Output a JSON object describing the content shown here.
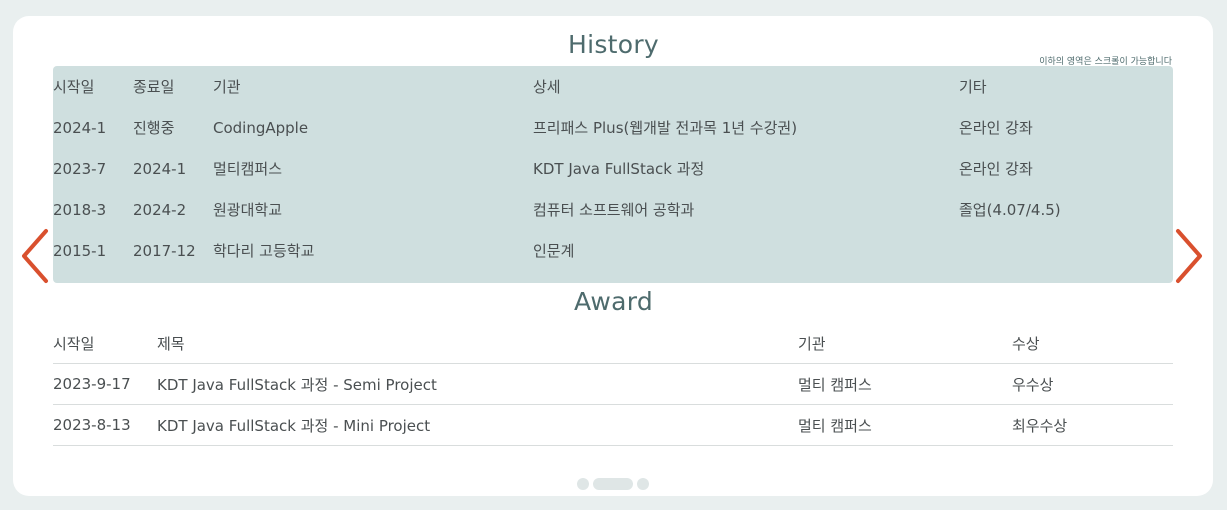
{
  "history": {
    "title": "History",
    "scroll_note": "이하의 영역은 스크롤이 가능합니다",
    "headers": [
      "시작일",
      "종료일",
      "기관",
      "상세",
      "기타"
    ],
    "rows": [
      [
        "2024-1",
        "진행중",
        "CodingApple",
        "프리패스 Plus(웹개발 전과목 1년 수강권)",
        "온라인 강좌"
      ],
      [
        "2023-7",
        "2024-1",
        "멀티캠퍼스",
        "KDT Java FullStack 과정",
        "온라인 강좌"
      ],
      [
        "2018-3",
        "2024-2",
        "원광대학교",
        "컴퓨터 소프트웨어 공학과",
        "졸업(4.07/4.5)"
      ],
      [
        "2015-1",
        "2017-12",
        "학다리 고등학교",
        "인문계",
        ""
      ]
    ]
  },
  "award": {
    "title": "Award",
    "headers": [
      "시작일",
      "제목",
      "기관",
      "수상"
    ],
    "rows": [
      [
        "2023-9-17",
        "KDT Java FullStack 과정 - Semi Project",
        "멀티 캠퍼스",
        "우수상"
      ],
      [
        "2023-8-13",
        "KDT Java FullStack 과정 - Mini Project",
        "멀티 캠퍼스",
        "최우수상"
      ]
    ]
  },
  "nav": {
    "prev_icon": "chevron-left-icon",
    "next_icon": "chevron-right-icon",
    "arrow_color": "#d9502e",
    "pagination": {
      "count": 3,
      "active_index": 1
    }
  },
  "colors": {
    "title": "#4e6b6d",
    "history_bg": "#cfdfdf",
    "page_bg": "#e9efef"
  }
}
